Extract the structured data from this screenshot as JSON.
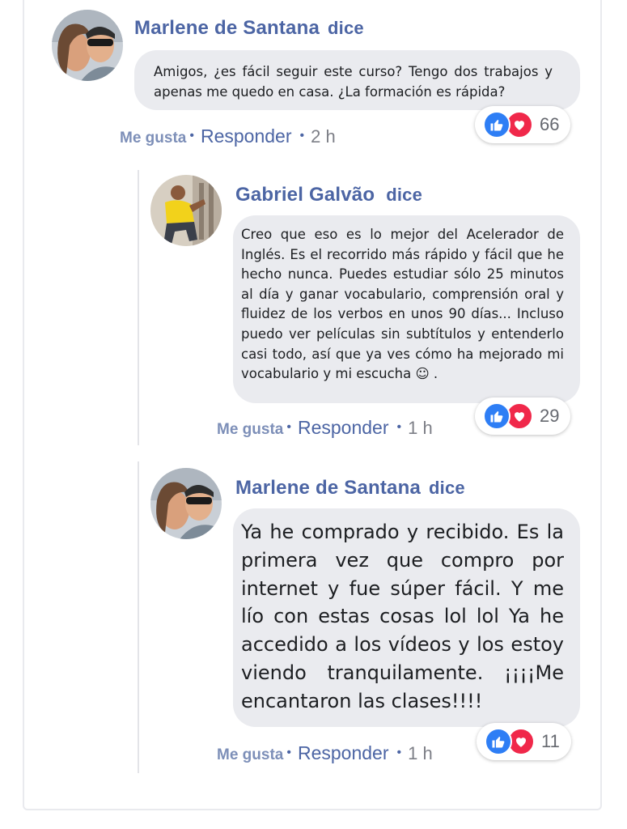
{
  "comments": [
    {
      "author": "Marlene de Santana",
      "verb": "dice",
      "text": "Amigos, ¿es fácil seguir este curso? Tengo dos trabajos y apenas me quedo en casa. ¿La formación es rápida?",
      "like_label": "Me gusta",
      "reply_label": "Responder",
      "time": "2 h",
      "reaction_count": "66",
      "avatar_icon": "couple-selfie-avatar"
    },
    {
      "author": "Gabriel Galvão",
      "verb": "dice",
      "text": "Creo que eso es lo mejor del Acelerador de Inglés. Es el recorrido más rápido y fácil que he hecho nunca. Puedes estudiar sólo 25 minutos al día y ganar vocabulario, comprensión oral y fluidez de los verbos en unos 90 días... Incluso puedo ver películas sin subtítulos y entenderlo casi todo, así que ya ves cómo ha mejorado mi vocabulario y mi escucha ☺ .",
      "like_label": "Me gusta",
      "reply_label": "Responder",
      "time": "1 h",
      "reaction_count": "29",
      "avatar_icon": "man-yellow-shirt-avatar"
    },
    {
      "author": "Marlene de Santana",
      "verb": "dice",
      "text": "Ya he comprado y recibido. Es la primera vez que compro por internet y fue súper fácil. Y me lío con estas cosas lol lol Ya he accedido a los vídeos y los estoy viendo tranquilamente. ¡¡¡¡Me encantaron las clases!!!!",
      "like_label": "Me gusta",
      "reply_label": "Responder",
      "time": "1 h",
      "reaction_count": "11",
      "avatar_icon": "couple-selfie-avatar"
    }
  ],
  "colors": {
    "name_blue": "#4c65a4",
    "bubble_bg": "#eaebef",
    "like_blue": "#2e7ef5",
    "love_red": "#f0284a"
  }
}
